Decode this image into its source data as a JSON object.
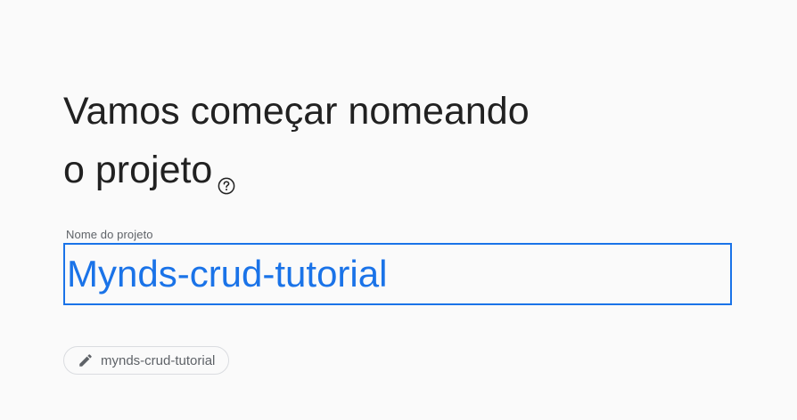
{
  "heading": {
    "line1": "Vamos começar nomeando",
    "line2": "o projeto",
    "help_icon": "help-circle-icon"
  },
  "project_name_field": {
    "label": "Nome do projeto",
    "value": "Mynds-crud-tutorial"
  },
  "project_id_chip": {
    "icon": "pencil-icon",
    "label": "mynds-crud-tutorial"
  },
  "colors": {
    "accent": "#1a73e8",
    "text_primary": "#212121",
    "text_secondary": "#5f6368",
    "background": "#fafafa"
  }
}
